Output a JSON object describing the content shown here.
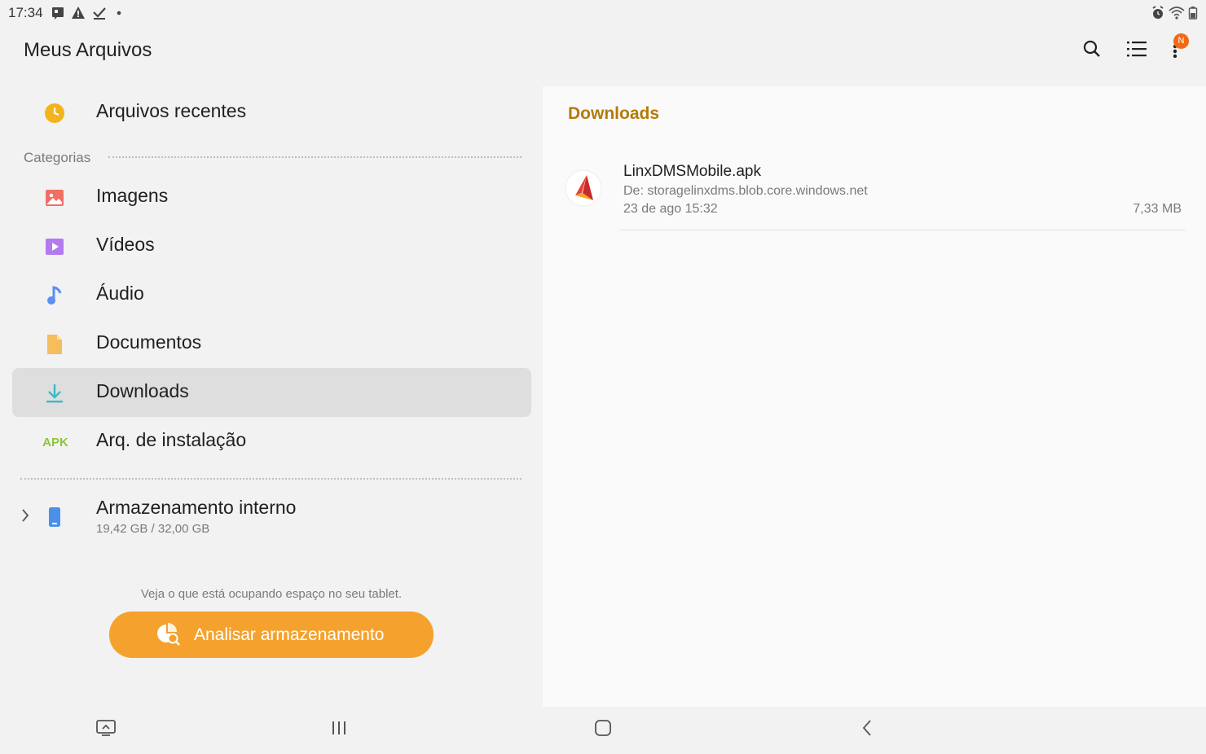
{
  "status_bar": {
    "time": "17:34",
    "left_icons": [
      "notification-icon",
      "warning-icon",
      "download-done-icon",
      "dot-icon"
    ],
    "right_icons": [
      "alarm-icon",
      "wifi-icon",
      "battery-icon"
    ]
  },
  "header": {
    "title": "Meus Arquivos",
    "actions": [
      "search-icon",
      "list-view-icon",
      "more-options-icon"
    ],
    "badge": "N"
  },
  "sidebar": {
    "recent": "Arquivos recentes",
    "categories_label": "Categorias",
    "items": [
      {
        "label": "Imagens",
        "icon": "image-icon"
      },
      {
        "label": "Vídeos",
        "icon": "video-icon"
      },
      {
        "label": "Áudio",
        "icon": "audio-icon"
      },
      {
        "label": "Documentos",
        "icon": "document-icon"
      },
      {
        "label": "Downloads",
        "icon": "download-icon",
        "selected": true
      },
      {
        "label": "Arq. de instalação",
        "icon": "apk-icon",
        "icon_text": "APK"
      }
    ],
    "storage": {
      "name": "Armazenamento interno",
      "usage": "19,42 GB / 32,00 GB"
    },
    "analyze_hint": "Veja o que está ocupando espaço no seu tablet.",
    "analyze_button": "Analisar armazenamento"
  },
  "content": {
    "folder_title": "Downloads",
    "files": [
      {
        "name": "LinxDMSMobile.apk",
        "source": "De: storagelinxdms.blob.core.windows.net",
        "date": "23 de ago 15:32",
        "size": "7,33 MB"
      }
    ]
  },
  "colors": {
    "accent": "#f4a22d",
    "folder_title": "#b57a0b",
    "badge": "#f26a16",
    "selected_bg": "#dedede"
  },
  "nav_bar": [
    "recent-apps-icon",
    "home-icon",
    "back-icon",
    "screenshot-icon"
  ]
}
